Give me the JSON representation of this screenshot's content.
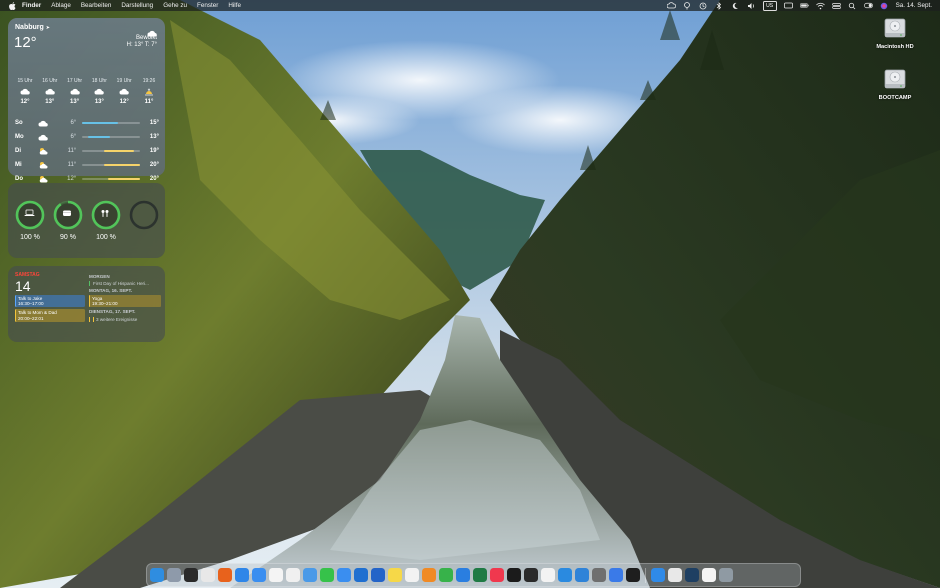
{
  "menubar": {
    "app_name": "Finder",
    "items": [
      "Ablage",
      "Bearbeiten",
      "Darstellung",
      "Gehe zu",
      "Fenster",
      "Hilfe"
    ],
    "keyboard_layout": "US",
    "clock": "Sa. 14. Sept.",
    "status_icons": [
      "creative-cloud-icon",
      "tree-icon",
      "time-machine-icon",
      "bluetooth-icon",
      "moon-icon",
      "volume-icon",
      "keyboard-icon",
      "rectangle-icon",
      "battery-icon",
      "wifi-icon",
      "control-center-icon",
      "search-icon",
      "toggle-icon",
      "siri-icon"
    ]
  },
  "weather": {
    "location": "Nabburg",
    "temperature": "12°",
    "condition": "Bewölkt",
    "hilo": "H: 13° T: 7°",
    "hourly": [
      {
        "time": "15 Uhr",
        "temp": "12°",
        "icon": "cloud-icon"
      },
      {
        "time": "16 Uhr",
        "temp": "13°",
        "icon": "cloud-icon"
      },
      {
        "time": "17 Uhr",
        "temp": "13°",
        "icon": "cloud-icon"
      },
      {
        "time": "18 Uhr",
        "temp": "13°",
        "icon": "cloud-icon"
      },
      {
        "time": "19 Uhr",
        "temp": "12°",
        "icon": "cloud-icon"
      },
      {
        "time": "19:26",
        "temp": "11°",
        "icon": "sunset-icon"
      }
    ],
    "daily": [
      {
        "day": "So",
        "low": "6°",
        "high": "15°",
        "icon": "cloud-icon",
        "range": [
          0.0,
          0.62
        ],
        "color": "#67c1e6"
      },
      {
        "day": "Mo",
        "low": "6°",
        "high": "13°",
        "icon": "cloud-icon",
        "range": [
          0.1,
          0.48
        ],
        "color": "#67c1e6"
      },
      {
        "day": "Di",
        "low": "11°",
        "high": "19°",
        "icon": "partly-cloudy-icon",
        "range": [
          0.38,
          0.9
        ],
        "color": "#f5d36a"
      },
      {
        "day": "Mi",
        "low": "11°",
        "high": "20°",
        "icon": "partly-cloudy-icon",
        "range": [
          0.38,
          1.0
        ],
        "color": "#f5d36a"
      },
      {
        "day": "Do",
        "low": "12°",
        "high": "20°",
        "icon": "partly-cloudy-icon",
        "range": [
          0.45,
          1.0
        ],
        "color": "#f5d36a"
      }
    ]
  },
  "batteries": [
    {
      "device": "laptop-icon",
      "percent": "100 %",
      "level": 1.0
    },
    {
      "device": "earbuds-case-icon",
      "percent": "90 %",
      "level": 0.9
    },
    {
      "device": "earbuds-icon",
      "percent": "100 %",
      "level": 1.0
    },
    {
      "device": "empty-slot",
      "percent": "",
      "level": 0.0
    }
  ],
  "calendar": {
    "weekday": "SAMSTAG",
    "date": "14",
    "today_events": [
      {
        "title": "Talk to Jake",
        "time": "16:30–17:00",
        "color": "blue"
      },
      {
        "title": "Talk to Mom & Dad",
        "time": "20:00–22:01",
        "color": "yellow"
      }
    ],
    "tomorrow_label": "MORGEN",
    "tomorrow_event": "First Day of Hispanic Heri...",
    "monday_label": "MONTAG, 16. SEPT.",
    "monday_event": {
      "title": "Yoga",
      "time": "19:30–21:00"
    },
    "tuesday_label": "DIENSTAG, 17. SEPT.",
    "tuesday_more": "3 weitere Ereignisse"
  },
  "desktop": {
    "disks": [
      {
        "label": "Macintosh HD"
      },
      {
        "label": "BOOTCAMP"
      }
    ]
  },
  "dock": {
    "apps": [
      {
        "name": "finder-icon",
        "color": "#2f8de0"
      },
      {
        "name": "launchpad-icon",
        "color": "#8e9aaa"
      },
      {
        "name": "terminal-icon",
        "color": "#2a2a2a"
      },
      {
        "name": "chrome-icon",
        "color": "#e8e8e8"
      },
      {
        "name": "firefox-icon",
        "color": "#e8621c"
      },
      {
        "name": "safari-icon",
        "color": "#2f86e8"
      },
      {
        "name": "mail-icon",
        "color": "#3a8ef0"
      },
      {
        "name": "calendar-icon",
        "color": "#f4f4f4"
      },
      {
        "name": "reminders-icon",
        "color": "#f0f0f0"
      },
      {
        "name": "icloud-icon",
        "color": "#4a9ae8"
      },
      {
        "name": "messages-icon",
        "color": "#36c24a"
      },
      {
        "name": "chat-icon",
        "color": "#3a8ef0"
      },
      {
        "name": "xcode-tools-icon",
        "color": "#1f6fd0"
      },
      {
        "name": "onepassword-icon",
        "color": "#2464c8"
      },
      {
        "name": "notes-icon",
        "color": "#f6d848"
      },
      {
        "name": "freeform-icon",
        "color": "#f2f2f2"
      },
      {
        "name": "pages-icon",
        "color": "#f08a24"
      },
      {
        "name": "numbers-icon",
        "color": "#37b24a"
      },
      {
        "name": "keynote-icon",
        "color": "#2a7ee0"
      },
      {
        "name": "excel-icon",
        "color": "#1f7a44"
      },
      {
        "name": "music-icon",
        "color": "#f0384e"
      },
      {
        "name": "roblox-icon",
        "color": "#1b1b1b"
      },
      {
        "name": "github-icon",
        "color": "#2b2b2b"
      },
      {
        "name": "photos-icon",
        "color": "#f3f3f3"
      },
      {
        "name": "altstore-icon",
        "color": "#2a8ae0"
      },
      {
        "name": "vscode-icon",
        "color": "#2f83d8"
      },
      {
        "name": "bootstrap-icon",
        "color": "#6f6f6f"
      },
      {
        "name": "app-sheet-icon",
        "color": "#3a7ae8"
      },
      {
        "name": "terminal-dark-icon",
        "color": "#1e1e1e"
      }
    ],
    "right_apps": [
      {
        "name": "app-store-icon",
        "color": "#2f8ae8"
      },
      {
        "name": "textedit-icon",
        "color": "#e8e8e8"
      },
      {
        "name": "vectornator-icon",
        "color": "#1e3f62"
      },
      {
        "name": "document-icon",
        "color": "#f4f4f4"
      },
      {
        "name": "trash-icon",
        "color": "#8f9aa3"
      }
    ]
  }
}
